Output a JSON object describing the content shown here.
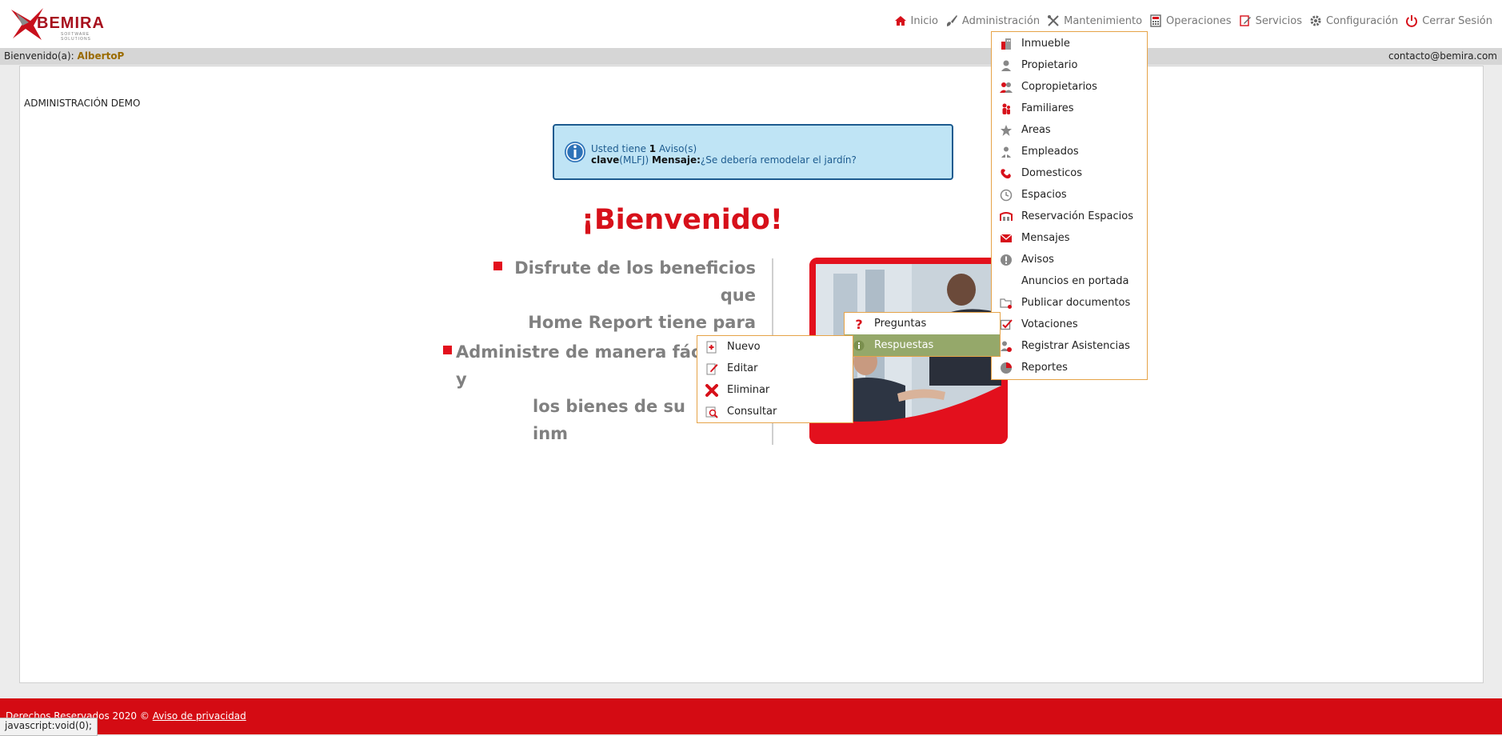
{
  "header": {
    "logo_text": "BEMIRA",
    "logo_subtext": "SOFTWARE SOLUTIONS",
    "nav": [
      {
        "label": "Inicio",
        "icon": "home-icon"
      },
      {
        "label": "Administración",
        "icon": "brush-icon"
      },
      {
        "label": "Mantenimiento",
        "icon": "tools-icon"
      },
      {
        "label": "Operaciones",
        "icon": "calculator-icon"
      },
      {
        "label": "Servicios",
        "icon": "edit-icon"
      },
      {
        "label": "Configuración",
        "icon": "gear-icon"
      },
      {
        "label": "Cerrar Sesión",
        "icon": "power-icon"
      }
    ]
  },
  "welcome_bar": {
    "greeting": "Bienvenido(a):",
    "username": "AlbertoP",
    "contact": "contacto@bemira.com"
  },
  "content": {
    "admin_title": "ADMINISTRACIÓN DEMO",
    "notice": {
      "prefix": "Usted tiene",
      "count": "1",
      "suffix": "Aviso(s)",
      "key_label": "clave",
      "key_value": "(MLFJ)",
      "message_label": "Mensaje:",
      "message_text": "¿Se debería remodelar el jardín?"
    },
    "welcome_heading": "¡Bienvenido!",
    "bullet1_line1": "Disfrute de los beneficios que",
    "bullet1_line2": "Home Report tiene para usted.",
    "bullet2_line1": "Administre de manera fácil y",
    "bullet2_line2": "los bienes de su inm"
  },
  "admin_menu": [
    {
      "label": "Inmueble",
      "icon": "building-icon"
    },
    {
      "label": "Propietario",
      "icon": "owner-icon"
    },
    {
      "label": "Copropietarios",
      "icon": "co-owners-icon"
    },
    {
      "label": "Familiares",
      "icon": "family-icon"
    },
    {
      "label": "Areas",
      "icon": "star-icon"
    },
    {
      "label": "Empleados",
      "icon": "employee-icon"
    },
    {
      "label": "Domesticos",
      "icon": "domestic-icon"
    },
    {
      "label": "Espacios",
      "icon": "clock-icon"
    },
    {
      "label": "Reservación Espacios",
      "icon": "reservation-icon"
    },
    {
      "label": "Mensajes",
      "icon": "mail-icon"
    },
    {
      "label": "Avisos",
      "icon": "alert-icon"
    },
    {
      "label": "Anuncios en portada",
      "icon": ""
    },
    {
      "label": "Publicar documentos",
      "icon": "folder-icon"
    },
    {
      "label": "Votaciones",
      "icon": "checkbox-icon"
    },
    {
      "label": "Registrar Asistencias",
      "icon": "attendance-icon"
    },
    {
      "label": "Reportes",
      "icon": "pie-chart-icon"
    }
  ],
  "votaciones_submenu": [
    {
      "label": "Preguntas",
      "icon": "question-icon"
    },
    {
      "label": "Respuestas",
      "icon": "info-icon",
      "active": true
    }
  ],
  "respuestas_submenu": [
    {
      "label": "Nuevo",
      "icon": "new-icon"
    },
    {
      "label": "Editar",
      "icon": "edit-icon"
    },
    {
      "label": "Eliminar",
      "icon": "delete-icon"
    },
    {
      "label": "Consultar",
      "icon": "search-icon"
    }
  ],
  "footer": {
    "copyright": "Derechos Reservados 2020 ©",
    "privacy_link": "Aviso de privacidad"
  },
  "status_bar": "javascript:void(0);",
  "colors": {
    "brand_red": "#d40b13",
    "menu_border": "#e6a348",
    "active_item": "#95a86a",
    "notice_bg": "#bfe4f5",
    "notice_border": "#1d5b8f"
  }
}
